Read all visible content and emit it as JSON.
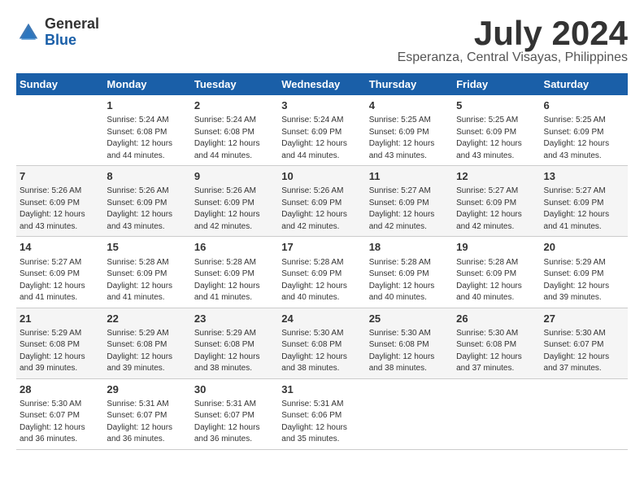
{
  "header": {
    "logo_general": "General",
    "logo_blue": "Blue",
    "month_year": "July 2024",
    "location": "Esperanza, Central Visayas, Philippines"
  },
  "days_of_week": [
    "Sunday",
    "Monday",
    "Tuesday",
    "Wednesday",
    "Thursday",
    "Friday",
    "Saturday"
  ],
  "weeks": [
    [
      {
        "day": "",
        "info": ""
      },
      {
        "day": "1",
        "info": "Sunrise: 5:24 AM\nSunset: 6:08 PM\nDaylight: 12 hours\nand 44 minutes."
      },
      {
        "day": "2",
        "info": "Sunrise: 5:24 AM\nSunset: 6:08 PM\nDaylight: 12 hours\nand 44 minutes."
      },
      {
        "day": "3",
        "info": "Sunrise: 5:24 AM\nSunset: 6:09 PM\nDaylight: 12 hours\nand 44 minutes."
      },
      {
        "day": "4",
        "info": "Sunrise: 5:25 AM\nSunset: 6:09 PM\nDaylight: 12 hours\nand 43 minutes."
      },
      {
        "day": "5",
        "info": "Sunrise: 5:25 AM\nSunset: 6:09 PM\nDaylight: 12 hours\nand 43 minutes."
      },
      {
        "day": "6",
        "info": "Sunrise: 5:25 AM\nSunset: 6:09 PM\nDaylight: 12 hours\nand 43 minutes."
      }
    ],
    [
      {
        "day": "7",
        "info": "Sunrise: 5:26 AM\nSunset: 6:09 PM\nDaylight: 12 hours\nand 43 minutes."
      },
      {
        "day": "8",
        "info": "Sunrise: 5:26 AM\nSunset: 6:09 PM\nDaylight: 12 hours\nand 43 minutes."
      },
      {
        "day": "9",
        "info": "Sunrise: 5:26 AM\nSunset: 6:09 PM\nDaylight: 12 hours\nand 42 minutes."
      },
      {
        "day": "10",
        "info": "Sunrise: 5:26 AM\nSunset: 6:09 PM\nDaylight: 12 hours\nand 42 minutes."
      },
      {
        "day": "11",
        "info": "Sunrise: 5:27 AM\nSunset: 6:09 PM\nDaylight: 12 hours\nand 42 minutes."
      },
      {
        "day": "12",
        "info": "Sunrise: 5:27 AM\nSunset: 6:09 PM\nDaylight: 12 hours\nand 42 minutes."
      },
      {
        "day": "13",
        "info": "Sunrise: 5:27 AM\nSunset: 6:09 PM\nDaylight: 12 hours\nand 41 minutes."
      }
    ],
    [
      {
        "day": "14",
        "info": "Sunrise: 5:27 AM\nSunset: 6:09 PM\nDaylight: 12 hours\nand 41 minutes."
      },
      {
        "day": "15",
        "info": "Sunrise: 5:28 AM\nSunset: 6:09 PM\nDaylight: 12 hours\nand 41 minutes."
      },
      {
        "day": "16",
        "info": "Sunrise: 5:28 AM\nSunset: 6:09 PM\nDaylight: 12 hours\nand 41 minutes."
      },
      {
        "day": "17",
        "info": "Sunrise: 5:28 AM\nSunset: 6:09 PM\nDaylight: 12 hours\nand 40 minutes."
      },
      {
        "day": "18",
        "info": "Sunrise: 5:28 AM\nSunset: 6:09 PM\nDaylight: 12 hours\nand 40 minutes."
      },
      {
        "day": "19",
        "info": "Sunrise: 5:28 AM\nSunset: 6:09 PM\nDaylight: 12 hours\nand 40 minutes."
      },
      {
        "day": "20",
        "info": "Sunrise: 5:29 AM\nSunset: 6:09 PM\nDaylight: 12 hours\nand 39 minutes."
      }
    ],
    [
      {
        "day": "21",
        "info": "Sunrise: 5:29 AM\nSunset: 6:08 PM\nDaylight: 12 hours\nand 39 minutes."
      },
      {
        "day": "22",
        "info": "Sunrise: 5:29 AM\nSunset: 6:08 PM\nDaylight: 12 hours\nand 39 minutes."
      },
      {
        "day": "23",
        "info": "Sunrise: 5:29 AM\nSunset: 6:08 PM\nDaylight: 12 hours\nand 38 minutes."
      },
      {
        "day": "24",
        "info": "Sunrise: 5:30 AM\nSunset: 6:08 PM\nDaylight: 12 hours\nand 38 minutes."
      },
      {
        "day": "25",
        "info": "Sunrise: 5:30 AM\nSunset: 6:08 PM\nDaylight: 12 hours\nand 38 minutes."
      },
      {
        "day": "26",
        "info": "Sunrise: 5:30 AM\nSunset: 6:08 PM\nDaylight: 12 hours\nand 37 minutes."
      },
      {
        "day": "27",
        "info": "Sunrise: 5:30 AM\nSunset: 6:07 PM\nDaylight: 12 hours\nand 37 minutes."
      }
    ],
    [
      {
        "day": "28",
        "info": "Sunrise: 5:30 AM\nSunset: 6:07 PM\nDaylight: 12 hours\nand 36 minutes."
      },
      {
        "day": "29",
        "info": "Sunrise: 5:31 AM\nSunset: 6:07 PM\nDaylight: 12 hours\nand 36 minutes."
      },
      {
        "day": "30",
        "info": "Sunrise: 5:31 AM\nSunset: 6:07 PM\nDaylight: 12 hours\nand 36 minutes."
      },
      {
        "day": "31",
        "info": "Sunrise: 5:31 AM\nSunset: 6:06 PM\nDaylight: 12 hours\nand 35 minutes."
      },
      {
        "day": "",
        "info": ""
      },
      {
        "day": "",
        "info": ""
      },
      {
        "day": "",
        "info": ""
      }
    ]
  ]
}
